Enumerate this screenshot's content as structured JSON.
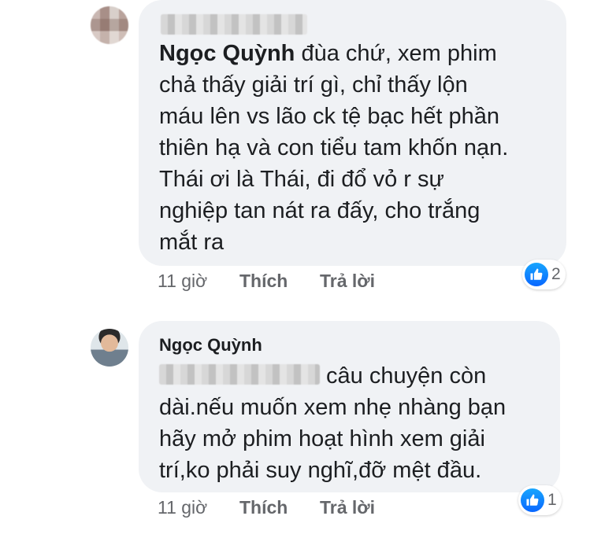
{
  "comments": [
    {
      "author_tag": "Ngọc Quỳnh",
      "lines": [
        " đùa chứ, xem phim",
        "chả thấy giải trí gì, chỉ thấy lộn",
        "máu lên vs lão ck tệ bạc hết phần",
        "thiên hạ và con tiểu tam khốn nạn.",
        "Thái ơi là Thái, đi đổ vỏ r sự",
        "nghiệp tan nát ra đấy, cho trắng",
        "mắt ra"
      ],
      "time": "11 giờ",
      "like_label": "Thích",
      "reply_label": "Trả lời",
      "reaction_count": "2",
      "reaction_icon": "like-icon",
      "accent": "#0866ff"
    },
    {
      "author": "Ngọc Quỳnh",
      "lines": [
        " câu chuyện còn",
        "dài.nếu muốn xem nhẹ nhàng bạn",
        "hãy mở phim hoạt hình xem giải",
        "trí,ko phải suy nghĩ,đỡ mệt đầu."
      ],
      "time": "11 giờ",
      "like_label": "Thích",
      "reply_label": "Trả lời",
      "reaction_count": "1",
      "reaction_icon": "like-icon",
      "accent": "#0866ff"
    }
  ]
}
